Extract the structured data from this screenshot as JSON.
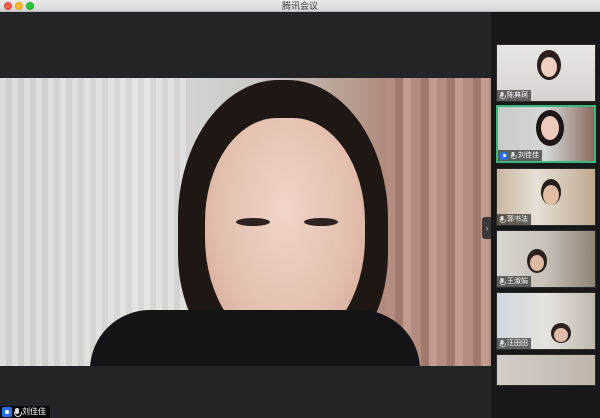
{
  "window": {
    "title": "腾讯会议"
  },
  "main_view": {
    "speaker_name": "刘佳佳",
    "speaker_is_self": true,
    "mic_state": "on"
  },
  "sidebar": {
    "participants": [
      {
        "name": "陈典珂",
        "mic_state": "on",
        "active": false,
        "is_self": false
      },
      {
        "name": "刘佳佳",
        "mic_state": "on",
        "active": true,
        "is_self": true
      },
      {
        "name": "郭书法",
        "mic_state": "on",
        "active": false,
        "is_self": false
      },
      {
        "name": "王淑娟",
        "mic_state": "on",
        "active": false,
        "is_self": false
      },
      {
        "name": "汪田田",
        "mic_state": "on",
        "active": false,
        "is_self": false
      }
    ],
    "collapse_icon": "chevron-right-icon"
  },
  "colors": {
    "active_border": "#3bb77e",
    "self_badge": "#2f6fe0",
    "background": "#232427"
  }
}
